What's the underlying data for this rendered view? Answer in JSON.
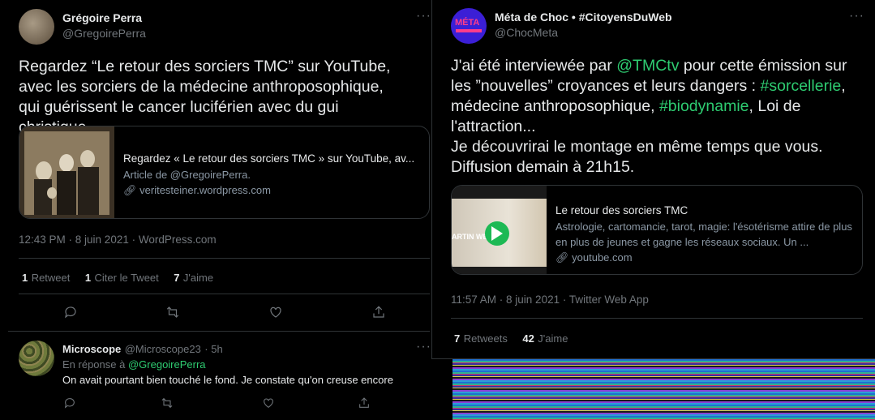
{
  "left_tweet": {
    "author_name": "Grégoire Perra",
    "author_handle": "@GregoirePerra",
    "text": "Regardez “Le retour des sorciers TMC” sur YouTube, avec les sorciers de la médecine anthroposophique, qui guérissent le cancer luciférien avec du gui christique.",
    "card": {
      "title": "Regardez « Le retour des sorciers TMC » sur YouTube, av...",
      "desc": "Article de @GregoirePerra.",
      "domain": "veritesteiner.wordpress.com"
    },
    "timestamp": "12:43 PM · 8 juin 2021 · WordPress.com",
    "stats": {
      "retweets_num": "1",
      "retweets_label": "Retweet",
      "quotes_num": "1",
      "quotes_label": "Citer le Tweet",
      "likes_num": "7",
      "likes_label": "J'aime"
    }
  },
  "reply": {
    "author_name": "Microscope",
    "author_handle": "@Microscope23",
    "time": "· 5h",
    "reply_prefix": "En réponse à",
    "reply_to": "@GregoirePerra",
    "text": "On avait pourtant bien touché le fond. Je constate qu'on creuse encore"
  },
  "right_tweet": {
    "author_name": "Méta de Choc • #CitoyensDuWeb",
    "author_handle": "@ChocMeta",
    "avatar_text": "MÉTA",
    "text_parts": {
      "p1": "J'ai été interviewée par ",
      "mention": "@TMCtv",
      "p2": " pour cette émission sur les ”nouvelles” croyances et leurs dangers : ",
      "tag1": "#sorcellerie",
      "p3": ", médecine anthroposophique, ",
      "tag2": "#biodynamie",
      "p4": ", Loi de l'attraction...",
      "p5": "Je découvrirai le montage en même temps que vous.",
      "p6": "Diffusion demain à 21h15."
    },
    "card": {
      "title": "Le retour des sorciers TMC",
      "desc": "Astrologie, cartomancie, tarot, magie: l'ésotérisme attire de plus en plus de jeunes et gagne les réseaux sociaux. Un ...",
      "domain": "youtube.com",
      "thumb_text": "ARTIN WEIL"
    },
    "timestamp": "11:57 AM · 8 juin 2021 · Twitter Web App",
    "stats": {
      "retweets_num": "7",
      "retweets_label": "Retweets",
      "likes_num": "42",
      "likes_label": "J'aime"
    }
  },
  "colors": {
    "background": "#000000",
    "mention": "#1da1f2",
    "hashtag": "#2ecc71",
    "muted": "#71767b",
    "divider": "#2f3336"
  }
}
